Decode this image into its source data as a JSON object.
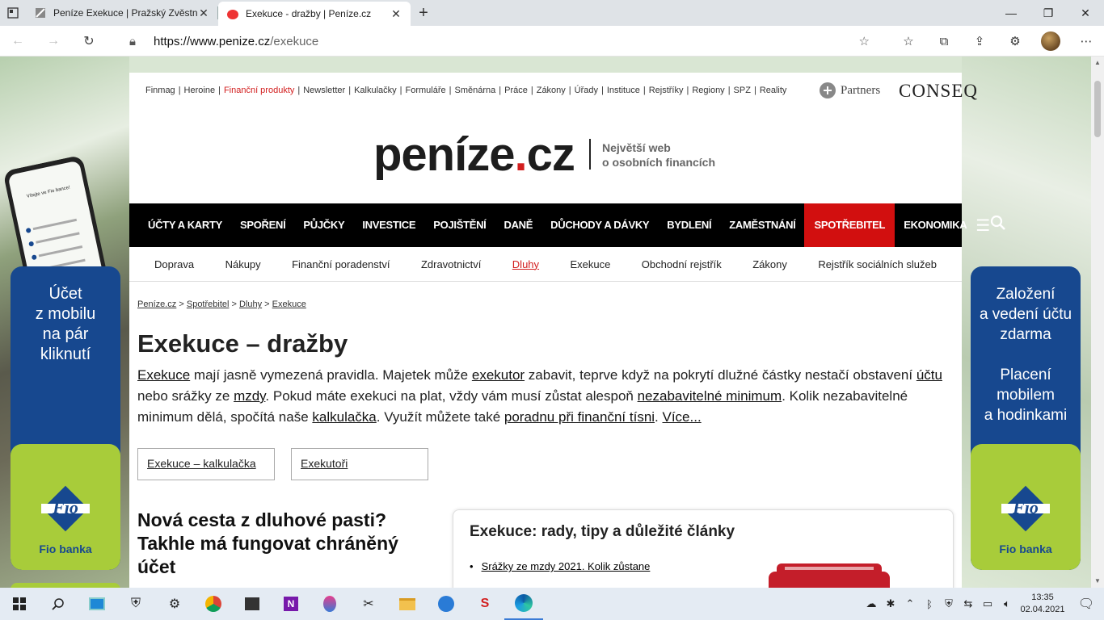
{
  "browser": {
    "tabs": [
      {
        "title": "Peníze Exekuce | Pražský Zvěstní",
        "active": false
      },
      {
        "title": "Exekuce - dražby | Peníze.cz",
        "active": true
      }
    ],
    "url_host": "https://www.penize.cz",
    "url_path": "/exekuce"
  },
  "page": {
    "top_links": [
      "Finmag",
      "Heroine",
      "Finanční produkty",
      "Newsletter",
      "Kalkulačky",
      "Formuláře",
      "Směnárna",
      "Práce",
      "Zákony",
      "Úřady",
      "Instituce",
      "Rejstříky",
      "Regiony",
      "SPZ",
      "Reality"
    ],
    "partners_label": "Partners",
    "conseq_label": "CONSEQ",
    "logo_text": "peníze",
    "logo_dot": ".",
    "logo_tld": "cz",
    "tagline_line1": "Největší web",
    "tagline_line2": "o osobních financích",
    "main_nav": [
      "ÚČTY A KARTY",
      "SPOŘENÍ",
      "PŮJČKY",
      "INVESTICE",
      "POJIŠTĚNÍ",
      "DANĚ",
      "DŮCHODY A DÁVKY",
      "BYDLENÍ",
      "ZAMĚSTNÁNÍ",
      "SPOTŘEBITEL",
      "EKONOMIKA"
    ],
    "main_nav_selected": "SPOTŘEBITEL",
    "sub_nav": [
      "Doprava",
      "Nákupy",
      "Finanční poradenství",
      "Zdravotnictví",
      "Dluhy",
      "Exekuce",
      "Obchodní rejstřík",
      "Zákony",
      "Rejstřík sociálních služeb"
    ],
    "sub_nav_selected": "Dluhy",
    "breadcrumb": [
      "Peníze.cz",
      "Spotřebitel",
      "Dluhy",
      "Exekuce"
    ],
    "title": "Exekuce – dražby",
    "intro": {
      "p1": "Exekuce",
      "p2": " mají jasně vymezená pravidla. Majetek může ",
      "p3": "exekutor",
      "p4": " zabavit, teprve když na pokrytí dlužné částky nestačí obstavení ",
      "p5": "účtu",
      "p6": " nebo srážky ze ",
      "p7": "mzdy",
      "p8": ". Pokud máte exekuci na plat, vždy vám musí zůstat alespoň ",
      "p9": "nezabavitelné minimum",
      "p10": ". Kolik nezabavitelné minimum dělá, spočítá naše ",
      "p11": "kalkulačka",
      "p12": ". Využít můžete také ",
      "p13": "poradnu při finanční tísni",
      "p14": ". ",
      "p15": "Více..."
    },
    "buttons": [
      "Exekuce – kalkulačka",
      "Exekutoři"
    ],
    "article_title": "Nová cesta z dluhové pasti? Takhle má fungovat chráněný účet",
    "card_title": "Exekuce: rady, tipy a důležité články",
    "card_items": [
      "Srážky ze mzdy 2021. Kolik zůstane"
    ]
  },
  "ads": {
    "left_text": "Účet\nz mobilu\nna pár\nkliknutí",
    "right_text": "Založení\na vedení účtu\nzdarma\n\nPlacení\nmobilem\na hodinkami",
    "brand": "Fio",
    "brand_label": "Fio banka",
    "phone_title": "Vítejte ve Fio bance!"
  },
  "taskbar": {
    "time": "13:35",
    "date": "02.04.2021"
  },
  "colors": {
    "accent_red": "#d21e1e",
    "fio_blue": "#17488f",
    "fio_green": "#a8cc3a"
  }
}
